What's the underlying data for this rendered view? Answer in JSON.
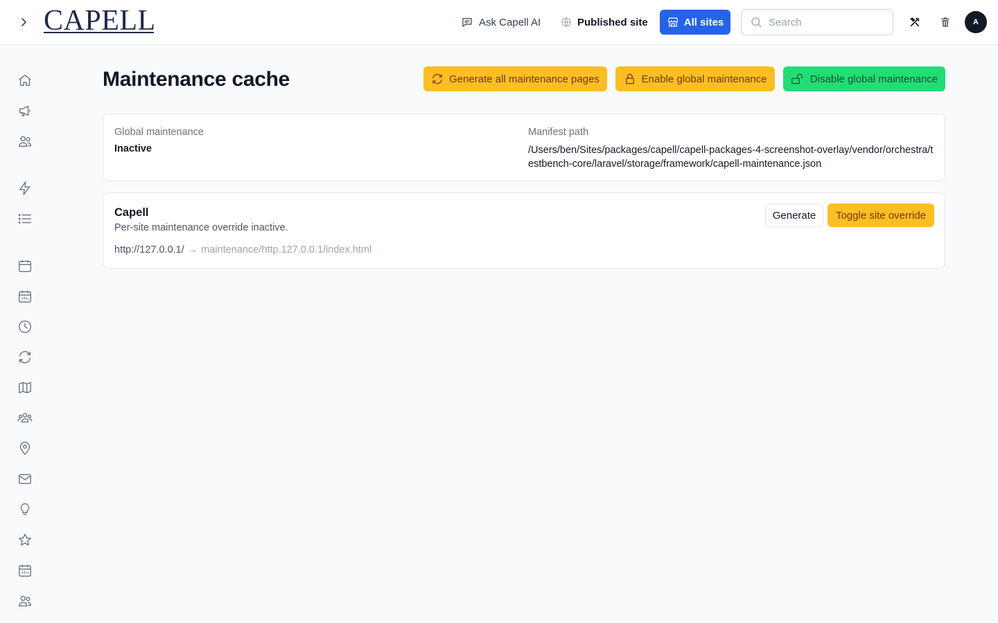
{
  "header": {
    "logo_text": "CAPELL",
    "ask_ai_label": "Ask Capell AI",
    "published_site_label": "Published site",
    "all_sites_label": "All sites",
    "search_placeholder": "Search",
    "avatar_initial": "A"
  },
  "sidebar": {
    "icons": [
      "home-icon",
      "megaphone-icon",
      "users-icon",
      "bolt-icon",
      "list-icon",
      "calendar-icon",
      "calendar-days-icon",
      "clock-icon",
      "refresh-icon",
      "map-icon",
      "user-group-icon",
      "map-pin-icon",
      "envelope-icon",
      "lightbulb-icon",
      "star-icon",
      "calendar-days-icon",
      "users-icon"
    ]
  },
  "main": {
    "title": "Maintenance cache",
    "actions": {
      "generate_all_label": "Generate all maintenance pages",
      "enable_global_label": "Enable global maintenance",
      "disable_global_label": "Disable global maintenance"
    },
    "info": {
      "global_maintenance_label": "Global maintenance",
      "global_maintenance_value": "Inactive",
      "manifest_path_label": "Manifest path",
      "manifest_path_value": "/Users/ben/Sites/packages/capell/capell-packages-4-screenshot-overlay/vendor/orchestra/testbench-core/laravel/storage/framework/capell-maintenance.json"
    },
    "sites": [
      {
        "name": "Capell",
        "status": "Per-site maintenance override inactive.",
        "url": "http://127.0.0.1/",
        "arrow": "→",
        "path": "maintenance/http.127.0.0.1/index.html",
        "generate_label": "Generate",
        "toggle_label": "Toggle site override"
      }
    ]
  },
  "colors": {
    "primary": "#2563eb",
    "warning": "#fbbf24",
    "success": "#22dd76"
  }
}
